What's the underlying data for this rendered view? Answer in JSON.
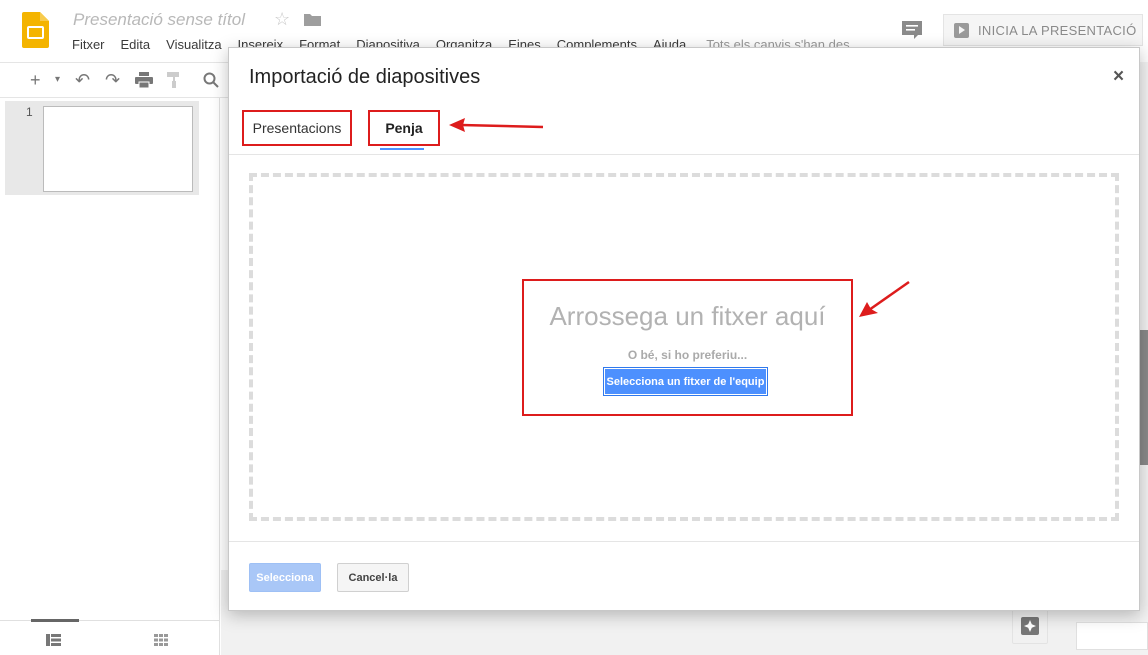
{
  "app": {
    "title": "Presentació sense títol",
    "menu": [
      "Fitxer",
      "Edita",
      "Visualitza",
      "Insereix",
      "Format",
      "Diapositiva",
      "Organitza",
      "Eines",
      "Complements",
      "Ajuda"
    ],
    "save_status": "Tots els canvis s'han des",
    "present_label": "INICIA LA PRESENTACIÓ"
  },
  "filmstrip": {
    "slides": [
      {
        "number": "1"
      }
    ]
  },
  "dialog": {
    "title": "Importació de diapositives",
    "close": "×",
    "tabs": [
      {
        "label": "Presentacions",
        "active": false
      },
      {
        "label": "Penja",
        "active": true
      }
    ],
    "dropzone": {
      "title": "Arrossega un fitxer aquí",
      "subtitle": "O bé, si ho preferiu...",
      "button": "Selecciona un fitxer de l'equip"
    },
    "footer": {
      "select": "Selecciona",
      "cancel": "Cancel·la"
    }
  },
  "colors": {
    "accent_blue": "#4d90fe",
    "annotation_red": "#dd1c1c",
    "slides_yellow": "#f4b400"
  }
}
